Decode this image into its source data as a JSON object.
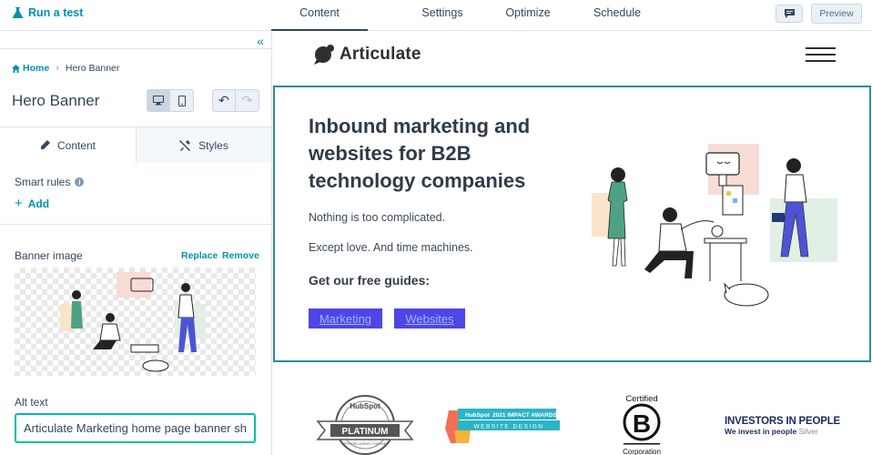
{
  "topbar": {
    "run_test_label": "Run a test",
    "tabs": [
      {
        "label": "Content",
        "active": true
      },
      {
        "label": "Settings"
      },
      {
        "label": "Optimize"
      },
      {
        "label": "Schedule"
      }
    ],
    "preview_label": "Preview"
  },
  "sidebar": {
    "breadcrumb": {
      "home": "Home",
      "current": "Hero Banner"
    },
    "title": "Hero Banner",
    "panel_tabs": {
      "content": "Content",
      "styles": "Styles"
    },
    "smart_rules": {
      "label": "Smart rules",
      "add": "Add"
    },
    "banner_image": {
      "label": "Banner image",
      "replace": "Replace",
      "remove": "Remove"
    },
    "alt_text": {
      "label": "Alt text",
      "value": "Articulate Marketing home page banner sh"
    }
  },
  "site": {
    "logo_text": "Articulate",
    "hero": {
      "title": "Inbound marketing and websites for B2B technology companies",
      "p1": "Nothing is too complicated.",
      "p2": "Except love. And time machines.",
      "guides": "Get our free guides:",
      "buttons": [
        "Marketing",
        "Websites"
      ]
    },
    "logos": {
      "hubspot_brand": "HubSpot",
      "platinum": "PLATINUM",
      "platinum_sub": "CERTIFIED AGENCY PARTNER",
      "impact_year": "2021 IMPACT AWARDS",
      "impact_sub": "WEBSITE DESIGN",
      "bcorp_top": "Certified",
      "bcorp_letter": "B",
      "bcorp_bottom": "Corporation",
      "iip_title": "INVESTORS IN PEOPLE",
      "iip_sub": "We invest in people",
      "iip_level": "Silver"
    }
  },
  "colors": {
    "accent_teal": "#0091ae",
    "input_focus": "#00bda5",
    "hero_border": "#2b8c9f",
    "guide_button": "#4f46e5"
  }
}
